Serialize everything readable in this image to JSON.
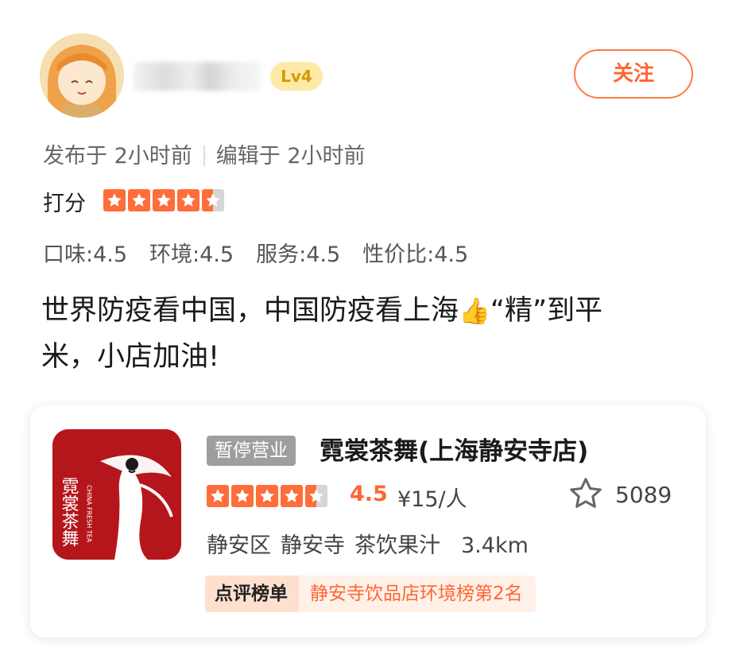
{
  "header": {
    "level_badge": "Lv4",
    "follow_label": "关注"
  },
  "meta": {
    "published": "发布于 2小时前",
    "edited": "编辑于 2小时前"
  },
  "rating": {
    "label": "打分",
    "value": 4.5,
    "max": 5
  },
  "scores": [
    {
      "text": "口味:4.5"
    },
    {
      "text": "环境:4.5"
    },
    {
      "text": "服务:4.5"
    },
    {
      "text": "性价比:4.5"
    }
  ],
  "review": {
    "line1": "世界防疫看中国，中国防疫看上海",
    "thumb": "👍",
    "line1_rest": "“精”到平",
    "line2": "米，小店加油!"
  },
  "shop": {
    "status_badge": "暂停营业",
    "name": "霓裳茶舞(上海静安寺店)",
    "rating_value": "4.5",
    "rating_stars": 4.5,
    "price": "¥15/人",
    "fav_count": "5089",
    "district": "静安区",
    "area": "静安寺",
    "category": "茶饮果汁",
    "distance": "3.4km",
    "rank_label": "点评榜单",
    "rank_text": "静安寺饮品店环境榜第2名",
    "logo_text": "霓裳茶舞",
    "logo_subtext": "CHINA FRESH TEA"
  },
  "colors": {
    "accent": "#ff6633",
    "star": "#ff6d3a",
    "logo_bg": "#b5161b",
    "badge_gold": "#d59a06"
  }
}
